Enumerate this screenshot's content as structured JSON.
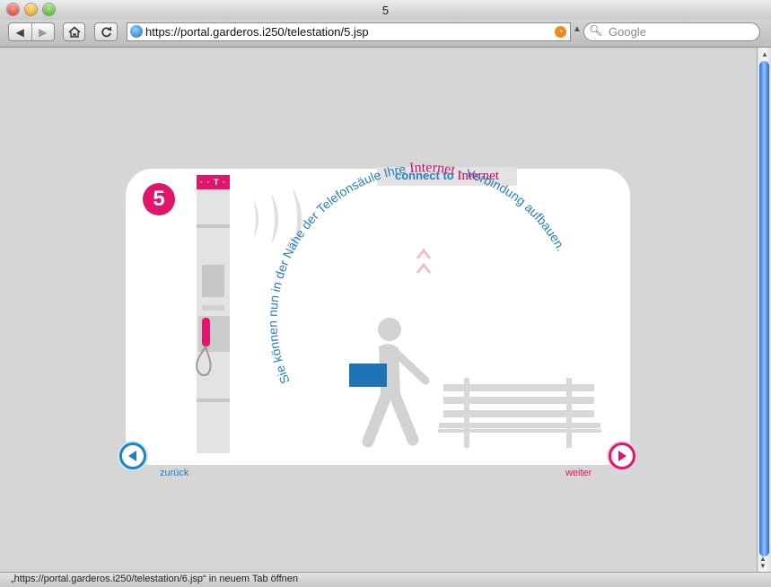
{
  "window": {
    "title": "5"
  },
  "toolbar": {
    "back_icon": "back-arrow-icon",
    "forward_icon": "forward-arrow-icon",
    "home_icon": "home-icon",
    "reload_icon": "reload-icon",
    "url": "https://portal.garderos.i250/telestation/5.jsp",
    "search_placeholder": "Google"
  },
  "status": {
    "text": "„https://portal.garderos.i250/telestation/6.jsp“ in neuem Tab öffnen"
  },
  "page": {
    "step_number": "5",
    "header": {
      "prefix": "connect to",
      "highlight": "Internet"
    },
    "pillar_logo": "· · T ·",
    "arc_text": {
      "part1": "Sie können nun in der Nähe der Telefonsäule Ihre ",
      "highlight": "Internet",
      "part2": " - Verbindung aufbauen."
    },
    "nav": {
      "prev_label": "zurück",
      "next_label": "weiter"
    }
  },
  "colors": {
    "magenta": "#e1146e",
    "blue": "#1e82c4"
  }
}
